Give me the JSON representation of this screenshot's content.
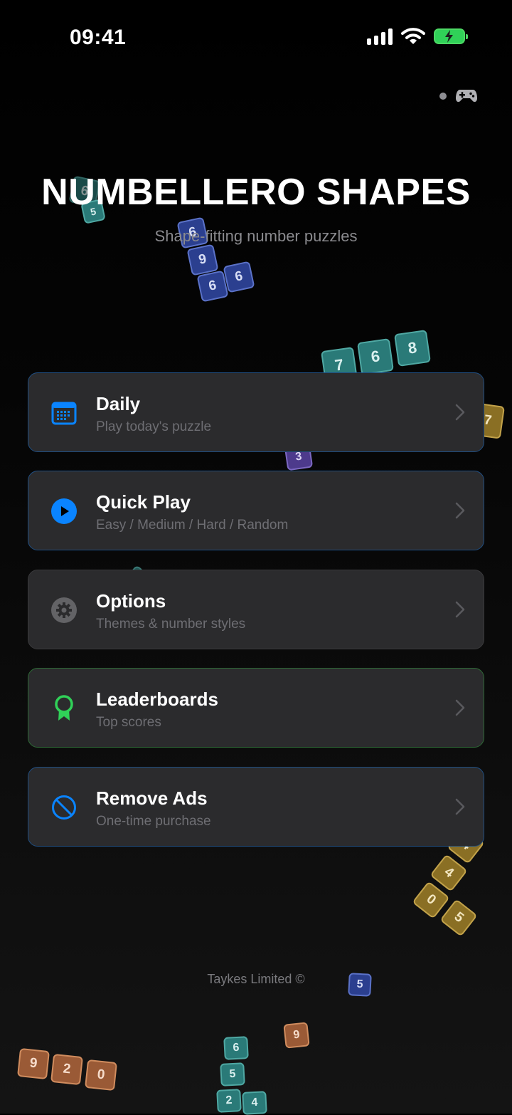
{
  "status": {
    "time": "09:41"
  },
  "app": {
    "title": "NUMBELLERO SHAPES",
    "subtitle": "Shape-fitting number puzzles"
  },
  "menu": [
    {
      "label": "Daily",
      "sub": "Play today's puzzle",
      "icon": "calendar-icon",
      "accent": "#0a84ff"
    },
    {
      "label": "Quick Play",
      "sub": "Easy / Medium / Hard / Random",
      "icon": "play-circle-icon",
      "accent": "#0a84ff"
    },
    {
      "label": "Options",
      "sub": "Themes & number styles",
      "icon": "gear-icon",
      "accent": "#636366"
    },
    {
      "label": "Leaderboards",
      "sub": "Top scores",
      "icon": "award-ribbon-icon",
      "accent": "#30d158"
    },
    {
      "label": "Remove Ads",
      "sub": "One-time purchase",
      "icon": "prohibited-icon",
      "accent": "#0a84ff"
    }
  ],
  "decor_tiles": [
    "6",
    "5",
    "6",
    "9",
    "6",
    "6",
    "7",
    "6",
    "8",
    "7",
    "3",
    "4",
    "4",
    "0",
    "5",
    "5",
    "9",
    "9",
    "2",
    "0",
    "6",
    "5",
    "2",
    "4"
  ],
  "footer": "Taykes Limited ©"
}
